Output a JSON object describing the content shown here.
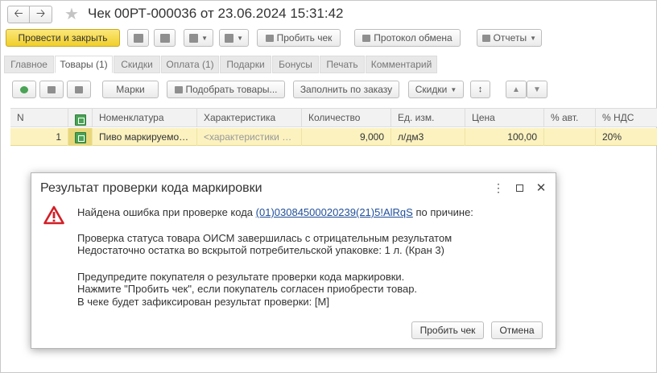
{
  "window": {
    "title": "Чек 00РТ-000036 от 23.06.2024 15:31:42"
  },
  "toolbar": {
    "post_and_close": "Провести и закрыть",
    "print_receipt": "Пробить чек",
    "exchange_log": "Протокол обмена",
    "reports": "Отчеты"
  },
  "tabs": [
    {
      "label": "Главное",
      "active": false
    },
    {
      "label": "Товары (1)",
      "active": true
    },
    {
      "label": "Скидки",
      "active": false
    },
    {
      "label": "Оплата (1)",
      "active": false
    },
    {
      "label": "Подарки",
      "active": false
    },
    {
      "label": "Бонусы",
      "active": false
    },
    {
      "label": "Печать",
      "active": false
    },
    {
      "label": "Комментарий",
      "active": false
    }
  ],
  "table_toolbar": {
    "marks": "Марки",
    "select_goods": "Подобрать товары...",
    "fill_by_order": "Заполнить по заказу",
    "discounts": "Скидки"
  },
  "table": {
    "columns": [
      "N",
      "Номенклатура",
      "Характеристика",
      "Количество",
      "Ед. изм.",
      "Цена",
      "% авт.",
      "% НДС"
    ],
    "rows": [
      {
        "n": "1",
        "item": "Пиво маркируемое…",
        "characteristic": "<характеристики н…",
        "quantity": "9,000",
        "unit": "л/дм3",
        "price": "100,00",
        "auto_pct": "",
        "vat": "20%"
      }
    ]
  },
  "dialog": {
    "title": "Результат проверки кода маркировки",
    "line1_prefix": "Найдена ошибка при проверке кода",
    "code_link": "(01)03084500020239(21)5!AlRqS",
    "line1_suffix": "по причине:",
    "line2": "Проверка статуса товара ОИСМ завершилась с отрицательным результатом",
    "line3": "Недостаточно остатка во вскрытой потребительской упаковке: 1 л. (Кран 3)",
    "line4": "Предупредите покупателя о результате проверки кода маркировки.",
    "line5": "Нажмите \"Пробить чек\", если покупатель согласен приобрести товар.",
    "line6": "В чеке будет зафиксирован результат проверки: [М]",
    "confirm_button": "Пробить чек",
    "cancel_button": "Отмена"
  }
}
